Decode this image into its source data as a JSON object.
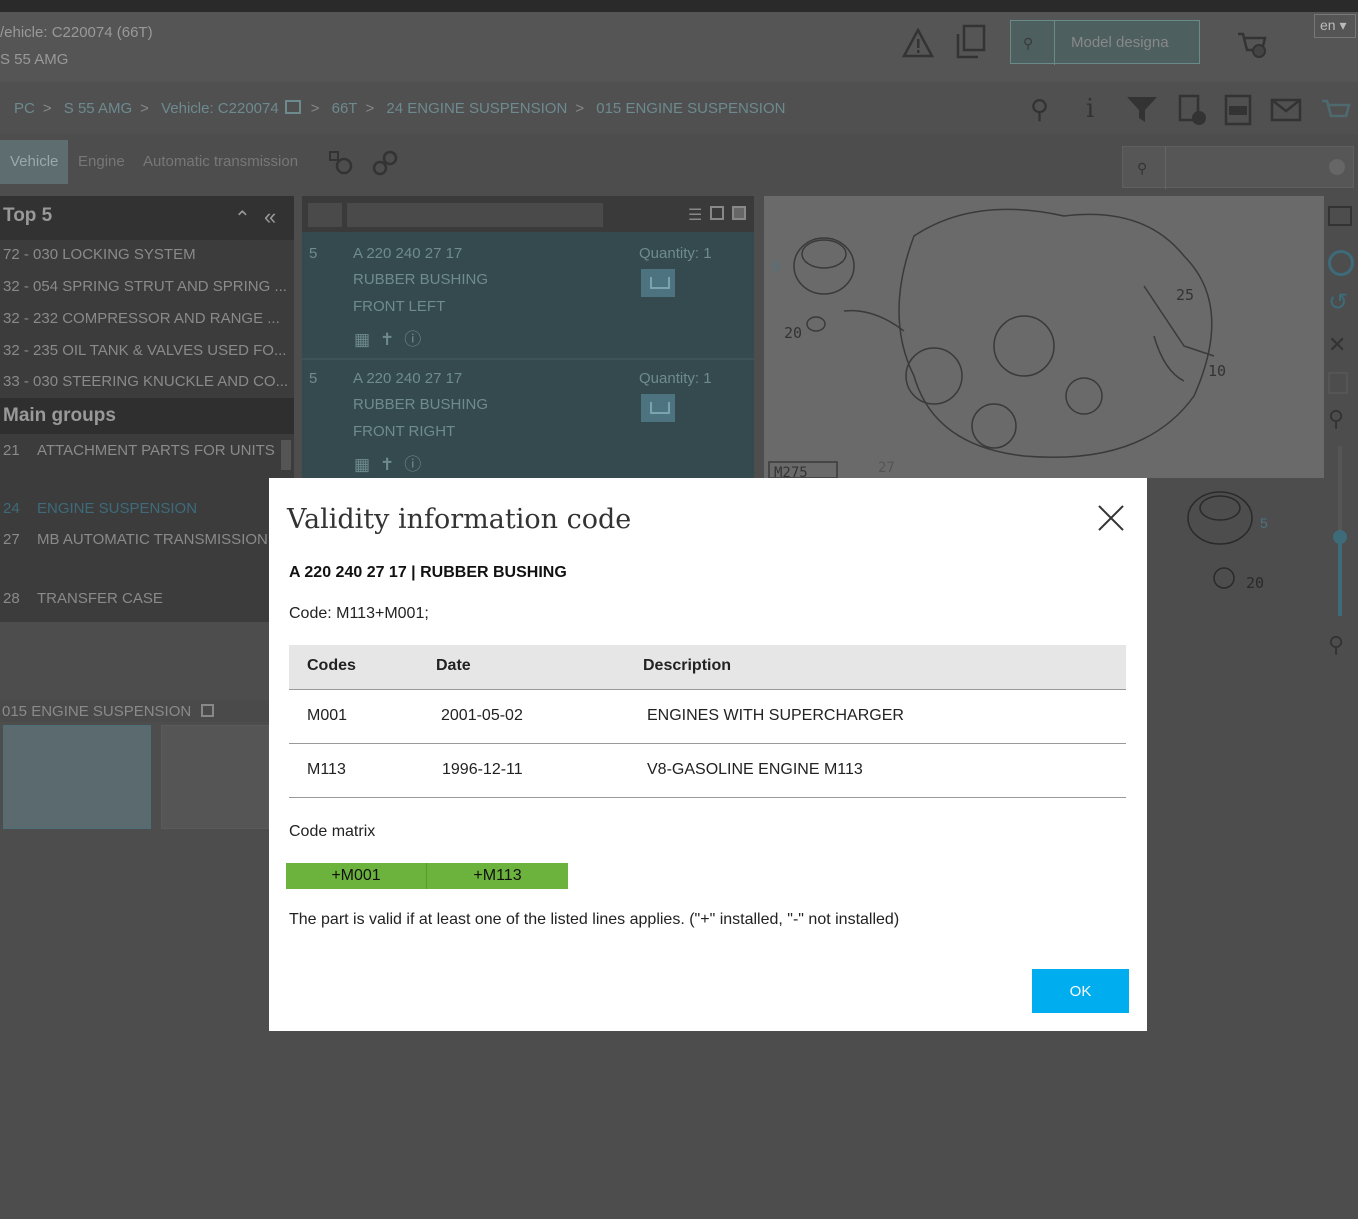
{
  "header": {
    "vehicle_line": "/ehicle: C220074 (66T)",
    "model_line": "S 55 AMG",
    "search_placeholder": "Model designa",
    "language": "en ▾",
    "icons": [
      "warning-icon",
      "copy-icon",
      "search-icon",
      "cart-add-icon"
    ]
  },
  "breadcrumb": {
    "items": [
      "PC",
      "S 55 AMG",
      "Vehicle: C220074",
      "66T",
      "24 ENGINE SUSPENSION",
      "015 ENGINE SUSPENSION"
    ],
    "separator": ">"
  },
  "toolbar_icons": [
    "zoom-search-icon",
    "info-icon",
    "filter-icon",
    "document-info-icon",
    "wis-icon",
    "mail-icon",
    "cart-icon"
  ],
  "tabs": [
    {
      "label": "Vehicle",
      "active": true
    },
    {
      "label": "Engine",
      "active": false
    },
    {
      "label": "Automatic transmission",
      "active": false
    }
  ],
  "left_panel": {
    "top5_title": "Top 5",
    "top5_items": [
      "72 - 030 LOCKING SYSTEM",
      "32 - 054 SPRING STRUT AND SPRING ...",
      "32 - 232 COMPRESSOR AND RANGE ...",
      "32 - 235 OIL TANK & VALVES USED FO...",
      "33 - 030 STEERING KNUCKLE AND CO..."
    ],
    "main_groups_title": "Main groups",
    "main_groups": [
      {
        "num": "21",
        "label": "ATTACHMENT PARTS FOR UNITS"
      },
      {
        "num": "24",
        "label": "ENGINE SUSPENSION"
      },
      {
        "num": "27",
        "label": "MB AUTOMATIC TRANSMISSION"
      },
      {
        "num": "28",
        "label": "TRANSFER CASE"
      }
    ]
  },
  "parts_list": [
    {
      "pos": "5",
      "number": "A 220 240 27 17",
      "name": "RUBBER BUSHING",
      "variant": "FRONT LEFT",
      "quantity": "Quantity: 1"
    },
    {
      "pos": "5",
      "number": "A 220 240 27 17",
      "name": "RUBBER BUSHING",
      "variant": "FRONT RIGHT",
      "quantity": "Quantity: 1"
    }
  ],
  "drawing": {
    "labels": [
      "5",
      "20",
      "25",
      "10",
      "M275",
      "27",
      "5",
      "20"
    ]
  },
  "section": {
    "title": "015 ENGINE SUSPENSION"
  },
  "modal": {
    "title": "Validity information code",
    "part": "A 220 240 27 17  |  RUBBER BUSHING",
    "code": "Code: M113+M001;",
    "table": {
      "headers": [
        "Codes",
        "Date",
        "Description"
      ],
      "rows": [
        [
          "M001",
          "2001-05-02",
          "ENGINES WITH SUPERCHARGER"
        ],
        [
          "M113",
          "1996-12-11",
          "V8-GASOLINE ENGINE M113"
        ]
      ]
    },
    "matrix_label": "Code matrix",
    "matrix": [
      "+M001",
      "+M113"
    ],
    "matrix_color": "#6cb33e",
    "note": "The part is valid if at least one of the listed lines applies. (\"+\" installed, \"-\" not installed)",
    "ok_label": "OK",
    "ok_color": "#00adef"
  }
}
